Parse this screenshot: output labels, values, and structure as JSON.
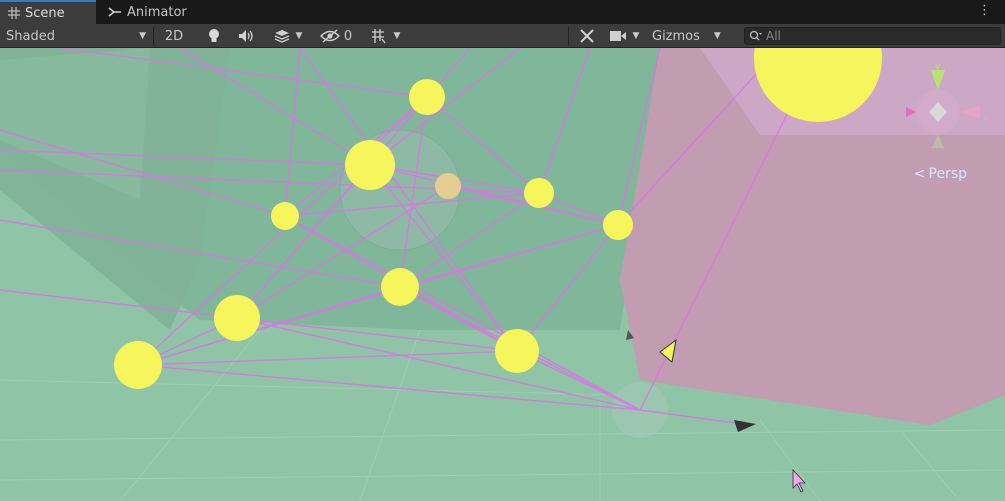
{
  "tabs": [
    {
      "label": "Scene",
      "icon": "grid-icon",
      "active": true
    },
    {
      "label": "Animator",
      "icon": "animator-icon",
      "active": false
    }
  ],
  "toolbar": {
    "shading_mode": "Shaded",
    "mode_2d": "2D",
    "hidden_count": "0",
    "gizmos_label": "Gizmos",
    "search_placeholder": "All"
  },
  "viewport": {
    "camera_label": "Persp",
    "gizmo_axes": [
      "y",
      "x"
    ],
    "colors": {
      "ground": "#8fc4a6",
      "wall": "#c29cb0",
      "connection_lines": "#dc74e8",
      "spheres": "#f6f55c"
    }
  }
}
